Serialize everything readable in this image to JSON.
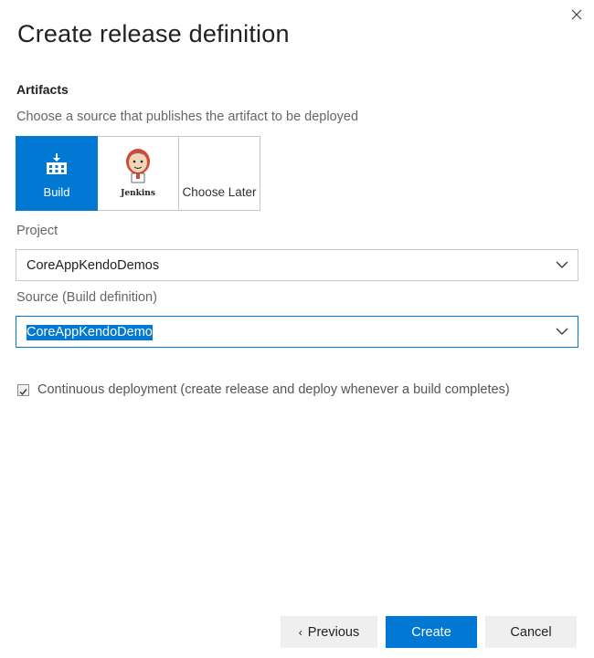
{
  "dialog": {
    "title": "Create release definition",
    "close_icon": "close-icon"
  },
  "artifacts": {
    "heading": "Artifacts",
    "hint": "Choose a source that publishes the artifact to be deployed",
    "sources": [
      {
        "label": "Build",
        "icon": "build-icon",
        "selected": true
      },
      {
        "label": "Jenkins",
        "icon": "jenkins-logo",
        "selected": false
      },
      {
        "label": "Choose Later",
        "icon": "",
        "selected": false
      }
    ]
  },
  "project": {
    "label": "Project",
    "value": "CoreAppKendoDemos"
  },
  "source": {
    "label": "Source (Build definition)",
    "value": "CoreAppKendoDemo"
  },
  "continuous_deployment": {
    "checked": true,
    "label": "Continuous deployment (create release and deploy whenever a build completes)"
  },
  "footer": {
    "previous_label": "Previous",
    "create_label": "Create",
    "cancel_label": "Cancel"
  },
  "colors": {
    "accent": "#0078d4",
    "secondary_button": "#efefef"
  }
}
